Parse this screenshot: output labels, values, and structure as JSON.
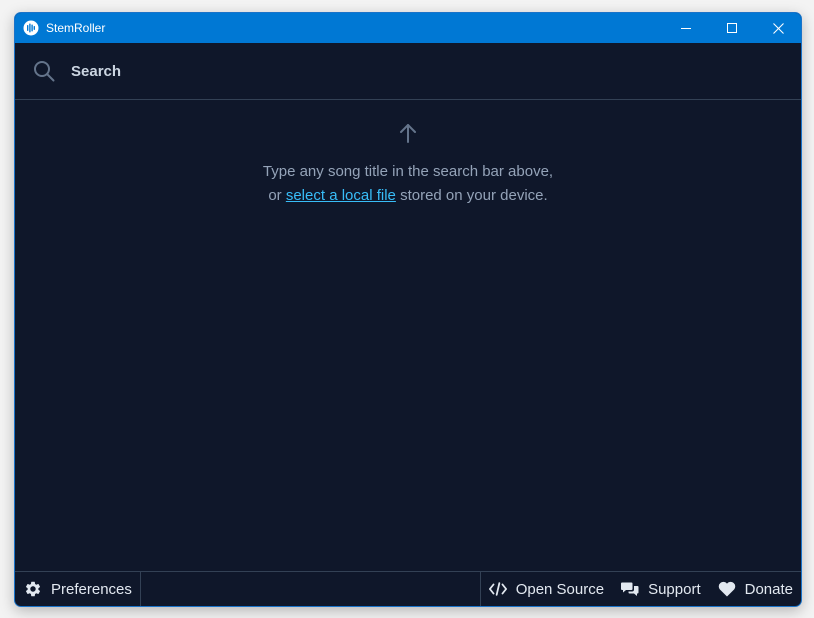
{
  "titlebar": {
    "app_title": "StemRoller",
    "app_icon": "stemroller-logo-icon",
    "controls": [
      "minimize-icon",
      "maximize-icon",
      "close-icon"
    ]
  },
  "search": {
    "placeholder": "Search",
    "value": "",
    "icon": "search-icon"
  },
  "hint": {
    "line1": "Type any song title in the search bar above,",
    "line2_prefix": "or ",
    "line2_link": "select a local file",
    "line2_suffix": " stored on your device."
  },
  "footer": {
    "preferences_label": "Preferences",
    "open_source_label": "Open Source",
    "support_label": "Support",
    "donate_label": "Donate"
  },
  "colors": {
    "titlebar": "#0078d4",
    "background": "#0f172a",
    "link": "#38bdf8",
    "muted_text": "#94a3b8",
    "border": "#334155"
  }
}
